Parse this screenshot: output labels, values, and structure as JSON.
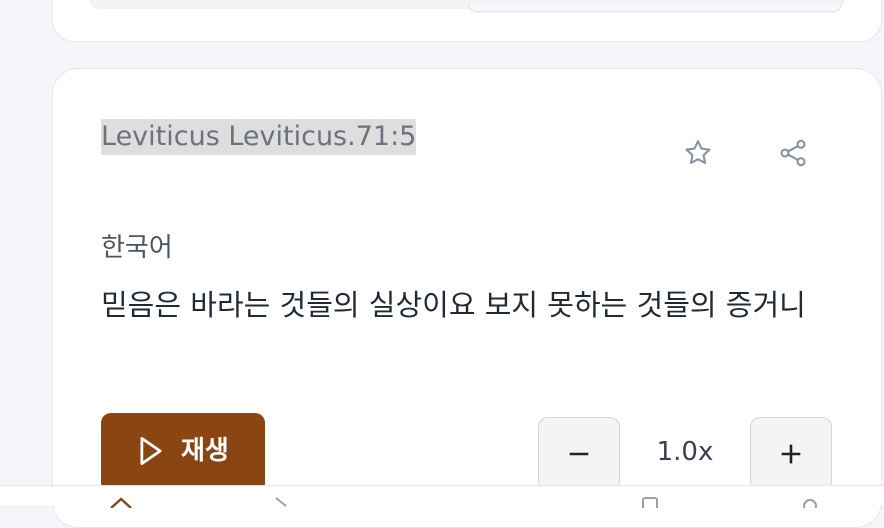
{
  "verse_card": {
    "reference": "Leviticus Leviticus.71:5",
    "language": "한국어",
    "text": "믿음은 바라는 것들의 실상이요 보지 못하는 것들의 증거니",
    "favorite_icon": "star-icon",
    "share_icon": "share-icon"
  },
  "audio": {
    "play_label": "재생",
    "play_icon": "play-icon",
    "speed": "1.0x",
    "decrease_icon": "minus-icon",
    "increase_icon": "plus-icon"
  },
  "bottom_nav": {
    "icons": [
      "home-icon",
      "play-icon",
      "bookmark-icon",
      "settings-icon"
    ]
  },
  "colors": {
    "accent": "#8b4513",
    "background": "#f3f5f9",
    "card": "#ffffff",
    "highlight": "#dedede"
  }
}
